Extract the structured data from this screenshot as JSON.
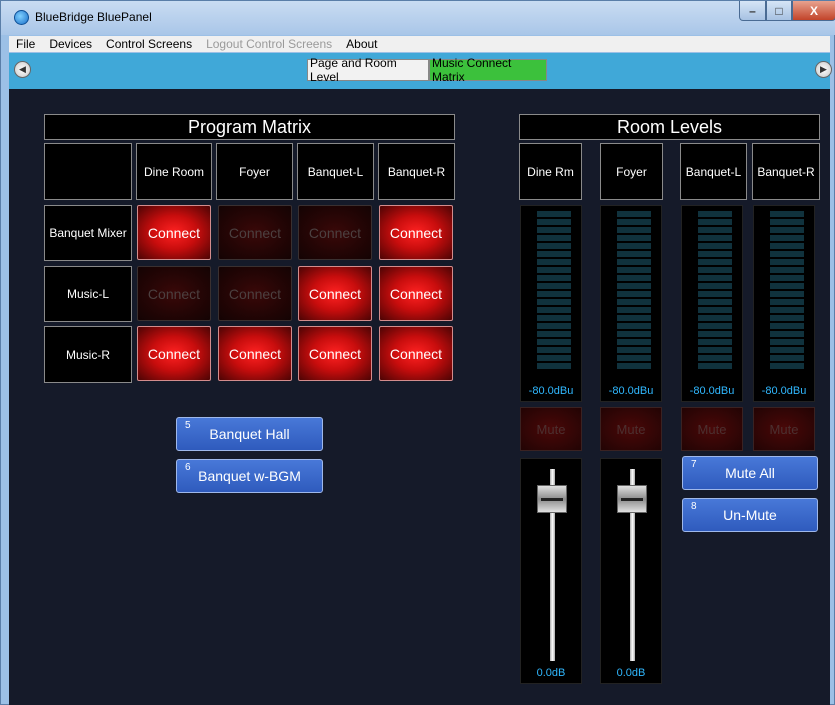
{
  "window": {
    "title": "BlueBridge BluePanel",
    "min_label": "–",
    "max_label": "□",
    "close_label": "X"
  },
  "menu": {
    "items": [
      "File",
      "Devices",
      "Control Screens",
      "Logout Control Screens",
      "About"
    ]
  },
  "tabs": {
    "items": [
      "Page and Room Level",
      "Music Connect Matrix"
    ],
    "active": "Music Connect Matrix"
  },
  "program_matrix": {
    "title": "Program Matrix",
    "columns": [
      "Dine Room",
      "Foyer",
      "Banquet-L",
      "Banquet-R"
    ],
    "rows": [
      {
        "label": "Banquet Mixer",
        "cells": [
          "Connect",
          "Connect",
          "Connect",
          "Connect"
        ],
        "states": [
          true,
          false,
          false,
          true
        ]
      },
      {
        "label": "Music-L",
        "cells": [
          "Connect",
          "Connect",
          "Connect",
          "Connect"
        ],
        "states": [
          false,
          false,
          true,
          true
        ]
      },
      {
        "label": "Music-R",
        "cells": [
          "Connect",
          "Connect",
          "Connect",
          "Connect"
        ],
        "states": [
          true,
          true,
          true,
          true
        ]
      }
    ]
  },
  "presets": [
    {
      "number": "5",
      "label": "Banquet Hall"
    },
    {
      "number": "6",
      "label": "Banquet w-BGM"
    }
  ],
  "room_levels": {
    "title": "Room Levels",
    "columns": [
      "Dine Rm",
      "Foyer",
      "Banquet-L",
      "Banquet-R"
    ],
    "meters": [
      "-80.0dBu",
      "-80.0dBu",
      "-80.0dBu",
      "-80.0dBu"
    ],
    "mute_labels": [
      "Mute",
      "Mute",
      "Mute",
      "Mute"
    ],
    "faders": [
      "0.0dB",
      "0.0dB"
    ]
  },
  "mute_controls": [
    {
      "number": "7",
      "label": "Mute All"
    },
    {
      "number": "8",
      "label": "Un-Mute"
    }
  ],
  "colors": {
    "connect_on": "#e01010",
    "connect_off": "#2a0606",
    "preset": "#3566c8",
    "meter_text": "#30b8ff",
    "active_tab": "#3cc13c"
  }
}
